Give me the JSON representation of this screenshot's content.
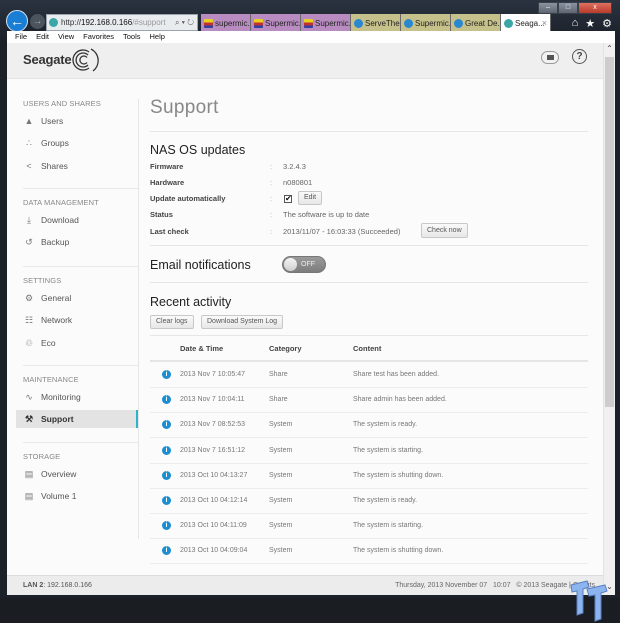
{
  "browser": {
    "address": {
      "scheme": "http://",
      "host": "192.168.0.166",
      "hash": "/#support"
    },
    "address_tools": "⌕ ▾ ↻",
    "tabs": [
      {
        "label": "supermic...",
        "style": "purple",
        "favicon": "tv-icon"
      },
      {
        "label": "Supermic...",
        "style": "purple",
        "favicon": "tv-icon"
      },
      {
        "label": "Supermic...",
        "style": "purple",
        "favicon": "tv-icon"
      },
      {
        "label": "ServeThe...",
        "style": "olive",
        "favicon": "servethehome-icon"
      },
      {
        "label": "Supermic...",
        "style": "olive",
        "favicon": "servethehome-icon"
      },
      {
        "label": "Great De...",
        "style": "olive",
        "favicon": "servethehome-icon"
      },
      {
        "label": "Seaga...",
        "style": "active",
        "favicon": "seagate-icon"
      }
    ],
    "menu": [
      "File",
      "Edit",
      "View",
      "Favorites",
      "Tools",
      "Help"
    ],
    "window_controls": {
      "minimize": "–",
      "maximize": "□",
      "close": "x"
    },
    "right_icons": {
      "home": "⌂",
      "favorites": "★",
      "settings": "⚙"
    }
  },
  "header": {
    "logo_text": "Seagate",
    "help_label": "?"
  },
  "sidebar": {
    "sections": [
      {
        "title": "USERS AND SHARES",
        "items": [
          {
            "label": "Users",
            "icon": "▲"
          },
          {
            "label": "Groups",
            "icon": "∴"
          },
          {
            "label": "Shares",
            "icon": "<"
          }
        ]
      },
      {
        "title": "DATA MANAGEMENT",
        "items": [
          {
            "label": "Download",
            "icon": "⤓"
          },
          {
            "label": "Backup",
            "icon": "↺"
          }
        ]
      },
      {
        "title": "SETTINGS",
        "items": [
          {
            "label": "General",
            "icon": "⚙"
          },
          {
            "label": "Network",
            "icon": "☷"
          },
          {
            "label": "Eco",
            "icon": "♲"
          }
        ]
      },
      {
        "title": "MAINTENANCE",
        "items": [
          {
            "label": "Monitoring",
            "icon": "∿"
          },
          {
            "label": "Support",
            "icon": "⚒",
            "active": true
          }
        ]
      },
      {
        "title": "STORAGE",
        "items": [
          {
            "label": "Overview",
            "icon": "▤"
          },
          {
            "label": "Volume 1",
            "icon": "▤"
          }
        ]
      }
    ]
  },
  "main": {
    "title": "Support",
    "nas_updates": {
      "heading": "NAS OS updates",
      "rows": [
        {
          "label": "Firmware",
          "value": "3.2.4.3"
        },
        {
          "label": "Hardware",
          "value": "n080801"
        },
        {
          "label": "Update automatically",
          "checked": true,
          "button": "Edit"
        },
        {
          "label": "Status",
          "value": "The software is up to date"
        },
        {
          "label": "Last check",
          "value": "2013/11/07 - 16:03:33 (Succeeded)",
          "button": "Check now"
        }
      ],
      "colon": ":"
    },
    "email": {
      "heading": "Email notifications",
      "toggle_label": "OFF",
      "enabled": false
    },
    "activity": {
      "heading": "Recent activity",
      "buttons": {
        "clear": "Clear logs",
        "download": "Download System Log"
      },
      "columns": [
        "Date & Time",
        "Category",
        "Content"
      ],
      "rows": [
        {
          "datetime": "2013 Nov 7 10:05:47",
          "category": "Share",
          "content": "Share test has been added."
        },
        {
          "datetime": "2013 Nov 7 10:04:11",
          "category": "Share",
          "content": "Share admin has been added."
        },
        {
          "datetime": "2013 Nov 7 08:52:53",
          "category": "System",
          "content": "The system is ready."
        },
        {
          "datetime": "2013 Nov 7 16:51:12",
          "category": "System",
          "content": "The system is starting."
        },
        {
          "datetime": "2013 Oct 10 04:13:27",
          "category": "System",
          "content": "The system is shutting down."
        },
        {
          "datetime": "2013 Oct 10 04:12:14",
          "category": "System",
          "content": "The system is ready."
        },
        {
          "datetime": "2013 Oct 10 04:11:09",
          "category": "System",
          "content": "The system is starting."
        },
        {
          "datetime": "2013 Oct 10 04:09:04",
          "category": "System",
          "content": "The system is shutting down."
        }
      ]
    }
  },
  "footer": {
    "lan_label": "LAN 2",
    "lan_ip": ": 192.168.0.166",
    "datetime": "Thursday, 2013 November 07   10:07",
    "copyright": "© 2013 Seagate",
    "credits": "Credits"
  },
  "colors": {
    "accent": "#2bb5c8",
    "info": "#1b8ed1"
  }
}
